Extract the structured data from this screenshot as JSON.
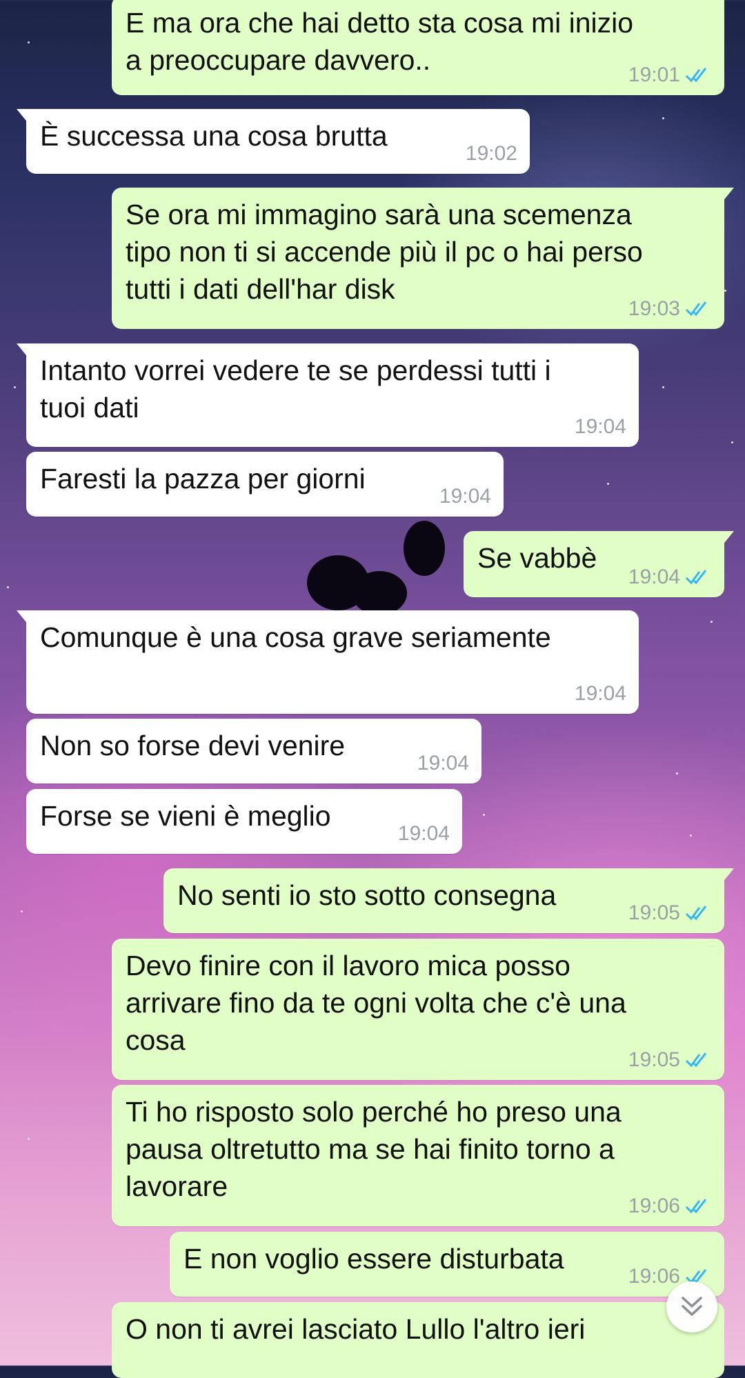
{
  "messages": [
    {
      "dir": "out",
      "text": "E ma ora che hai detto sta cosa mi inizio\na preoccupare davvero..",
      "time": "19:01",
      "read": true
    },
    {
      "dir": "in",
      "text": "È successa una cosa brutta",
      "time": "19:02"
    },
    {
      "dir": "out",
      "text": "Se ora mi immagino sarà una scemenza\ntipo non ti si accende più il pc o hai perso\ntutti i dati dell'har disk",
      "time": "19:03",
      "read": true
    },
    {
      "dir": "in",
      "text": "Intanto vorrei vedere te se perdessi tutti i\ntuoi dati",
      "time": "19:04"
    },
    {
      "dir": "in",
      "text": "Faresti la pazza per giorni",
      "time": "19:04"
    },
    {
      "dir": "out",
      "text": "Se vabbè",
      "time": "19:04",
      "read": true
    },
    {
      "dir": "in",
      "text": "Comunque è una cosa grave seriamente",
      "time": "19:04"
    },
    {
      "dir": "in",
      "text": "Non so forse devi venire",
      "time": "19:04"
    },
    {
      "dir": "in",
      "text": "Forse se vieni è meglio",
      "time": "19:04"
    },
    {
      "dir": "out",
      "text": "No senti io sto sotto consegna",
      "time": "19:05",
      "read": true
    },
    {
      "dir": "out",
      "text": "Devo finire con il lavoro mica posso\narrivare fino da te ogni volta che c'è una\ncosa",
      "time": "19:05",
      "read": true
    },
    {
      "dir": "out",
      "text": "Ti ho risposto solo perché ho preso una\npausa oltretutto ma se hai finito torno a\nlavorare",
      "time": "19:06",
      "read": true
    },
    {
      "dir": "out",
      "text": "E non voglio essere disturbata",
      "time": "19:06",
      "read": true
    },
    {
      "dir": "out",
      "text": "O non ti avrei lasciato Lullo l'altro ieri",
      "time": ""
    }
  ],
  "scroll_button": {
    "icon": "double-chevron-down-icon"
  },
  "colors": {
    "outgoing": "#e1fec6",
    "incoming": "#ffffff",
    "read_ticks": "#34b7f1",
    "time": "#9aa0a6"
  }
}
